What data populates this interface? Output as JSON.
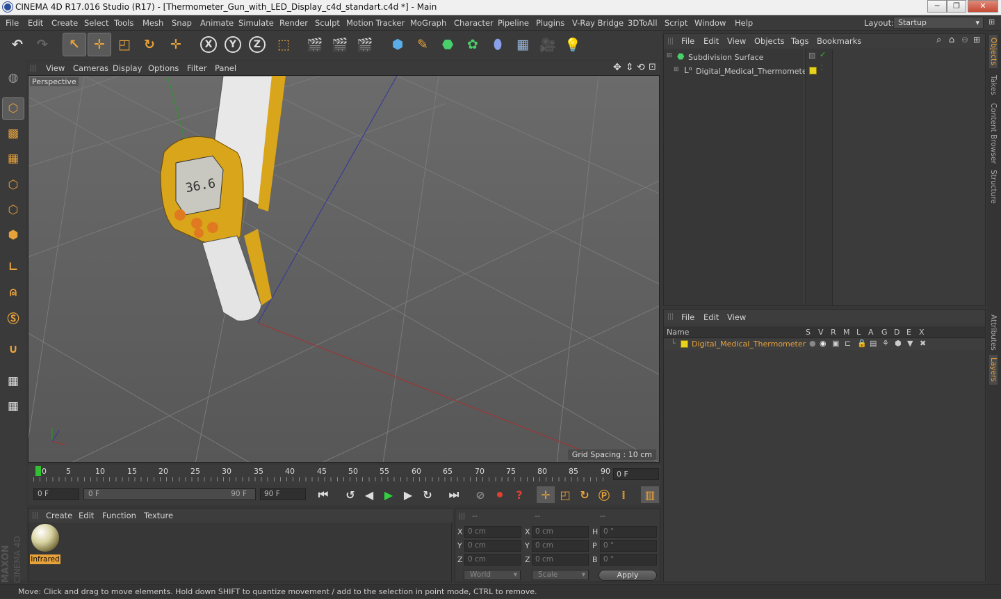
{
  "window": {
    "title": "CINEMA 4D R17.016 Studio (R17) - [Thermometer_Gun_with_LED_Display_c4d_standart.c4d *] - Main",
    "minimize": "─",
    "maximize": "❐",
    "close": "✕"
  },
  "menubar": {
    "items": [
      "File",
      "Edit",
      "Create",
      "Select",
      "Tools",
      "Mesh",
      "Snap",
      "Animate",
      "Simulate",
      "Render",
      "Sculpt",
      "Motion Tracker",
      "MoGraph",
      "Character",
      "Pipeline",
      "Plugins",
      "V-Ray Bridge",
      "3DToAll",
      "Script",
      "Window",
      "Help"
    ],
    "layout_label": "Layout:",
    "layout_value": "Startup"
  },
  "toolbar": {
    "icons": [
      "undo-icon",
      "redo-icon",
      "live-selection-icon",
      "move-icon",
      "scale-icon",
      "rotate-icon",
      "recent-tool-icon",
      "x-axis-lock-icon",
      "y-axis-lock-icon",
      "z-axis-lock-icon",
      "world-coordinates-icon",
      "render-view-icon",
      "render-picture-viewer-icon",
      "edit-render-settings-icon",
      "cube-icon",
      "pen-spline-icon",
      "subdivision-icon",
      "cloner-icon",
      "deformer-icon",
      "floor-icon",
      "camera-icon",
      "light-icon"
    ],
    "axis": {
      "x": "X",
      "y": "Y",
      "z": "Z"
    }
  },
  "viewport": {
    "menu": [
      "View",
      "Cameras",
      "Display",
      "Options",
      "Filter",
      "Panel"
    ],
    "camera_label": "Perspective",
    "grid_spacing": "Grid Spacing : 10 cm",
    "display_reading": "36.6"
  },
  "timeline": {
    "ticks": [
      "0",
      "5",
      "10",
      "15",
      "20",
      "25",
      "30",
      "35",
      "40",
      "45",
      "50",
      "55",
      "60",
      "65",
      "70",
      "75",
      "80",
      "85",
      "90"
    ],
    "current_frame": "0 F"
  },
  "transport": {
    "start": "0 F",
    "range_start": "0 F",
    "range_end": "90 F",
    "end": "90 F"
  },
  "material_manager": {
    "menu": [
      "Create",
      "Edit",
      "Function",
      "Texture"
    ],
    "material_name": "Infrared"
  },
  "coordinates": {
    "headers": [
      "--",
      "--",
      "--"
    ],
    "rows": [
      {
        "a": "X",
        "av": "0 cm",
        "b": "X",
        "bv": "0 cm",
        "c": "H",
        "cv": "0 °"
      },
      {
        "a": "Y",
        "av": "0 cm",
        "b": "Y",
        "bv": "0 cm",
        "c": "P",
        "cv": "0 °"
      },
      {
        "a": "Z",
        "av": "0 cm",
        "b": "Z",
        "bv": "0 cm",
        "c": "B",
        "cv": "0 °"
      }
    ],
    "mode1": "World",
    "mode2": "Scale",
    "apply": "Apply"
  },
  "object_manager": {
    "menu": [
      "File",
      "Edit",
      "View",
      "Objects",
      "Tags",
      "Bookmarks"
    ],
    "objects": [
      "Subdivision Surface",
      "Digital_Medical_Thermometer"
    ]
  },
  "layer_manager": {
    "menu": [
      "File",
      "Edit",
      "View"
    ],
    "name_header": "Name",
    "col_headers": [
      "S",
      "V",
      "R",
      "M",
      "L",
      "A",
      "G",
      "D",
      "E",
      "X"
    ],
    "layer_name": "Digital_Medical_Thermometer"
  },
  "side_tabs": [
    "Objects",
    "Takes",
    "Content Browser",
    "Structure",
    "Attributes",
    "Layers"
  ],
  "status": "Move: Click and drag to move elements. Hold down SHIFT to quantize movement / add to the selection in point mode, CTRL to remove.",
  "brand": {
    "line1": "MAXON",
    "line2": "CINEMA 4D"
  },
  "colors": {
    "accent": "#e8a23a",
    "thermo_yellow": "#d9a51a",
    "layer_yellow": "#e8d21c"
  }
}
